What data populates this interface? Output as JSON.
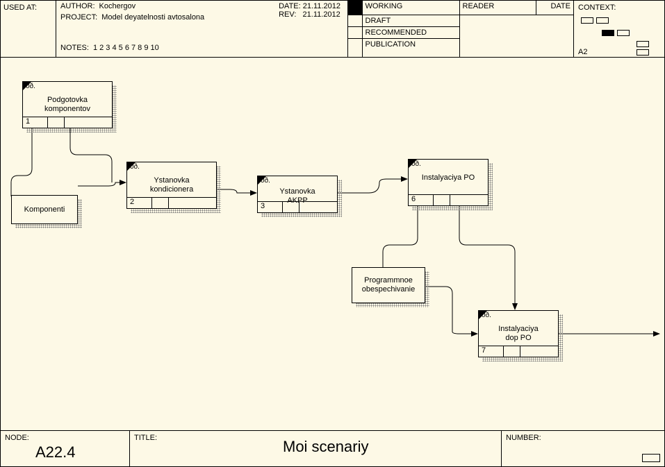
{
  "header": {
    "usedAtLabel": "USED AT:",
    "authorLabel": "AUTHOR:",
    "authorValue": "Kochergov",
    "projectLabel": "PROJECT:",
    "projectValue": "Model deyatelnosti avtosalona",
    "notesLabel": "NOTES:",
    "notesValue": "1  2  3  4  5  6  7  8  9  10",
    "dateLabel": "DATE:",
    "dateValue": "21.11.2012",
    "revLabel": "REV:",
    "revValue": "21.11.2012",
    "status": {
      "working": "WORKING",
      "draft": "DRAFT",
      "recommended": "RECOMMENDED",
      "publication": "PUBLICATION",
      "reader": "READER",
      "dateCol": "DATE"
    },
    "contextLabel": "CONTEXT:",
    "contextCode": "A2"
  },
  "footer": {
    "nodeLabel": "NODE:",
    "nodeValue": "A22.4",
    "titleLabel": "TITLE:",
    "titleValue": "Moi scenariy",
    "numberLabel": "NUMBER:"
  },
  "boxes": {
    "b1": {
      "id": "0ð.",
      "label": "Podgotovka\nkomponentov",
      "num": "1"
    },
    "b2": {
      "id": "0ð.",
      "label": "Ystanovka\nkondicionera",
      "num": "2"
    },
    "b3": {
      "id": "0ð.",
      "label": "Ystanovka\nAKPP",
      "num": "3"
    },
    "b4": {
      "id": "0ð.",
      "label": "Instalyaciya PO",
      "num": "6"
    },
    "b5": {
      "id": "0ð.",
      "label": "Instalyaciya\ndop PO",
      "num": "7"
    },
    "d1": {
      "label": "Komponenti"
    },
    "d2": {
      "label": "Programmnoe\nobespechivanie"
    }
  }
}
